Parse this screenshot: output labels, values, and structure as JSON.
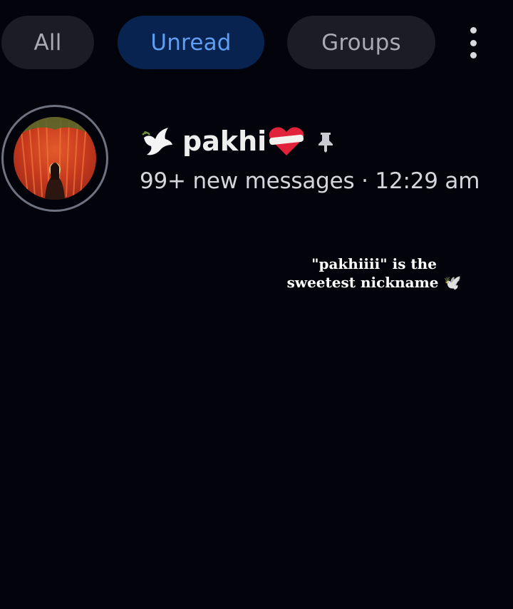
{
  "filters": {
    "all_label": "All",
    "unread_label": "Unread",
    "groups_label": "Groups",
    "active": "Unread",
    "more_icon": "vertical-ellipsis"
  },
  "chat": {
    "name": "pakhi",
    "name_prefix_emoji": "🕊️",
    "name_suffix_emoji": "❤️‍🩹",
    "pinned": true,
    "preview_line": "99+ new messages · 12:29 am"
  },
  "overlay": {
    "caption": "\"pakhiiii\" is the sweetest nickname 🕊️"
  },
  "colors": {
    "background": "#03030b",
    "chip_bg": "#1b1c24",
    "chip_text": "#a9aab4",
    "active_chip_bg": "#08234f",
    "active_chip_text": "#5f9ef2"
  }
}
